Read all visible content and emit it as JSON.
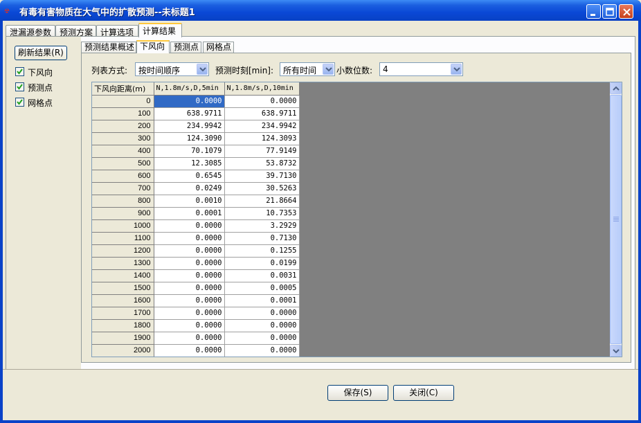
{
  "window": {
    "title": "有毒有害物质在大气中的扩散预测--未标题1",
    "icon": "app-icon",
    "controls": [
      "minimize-icon",
      "maximize-icon",
      "close-icon"
    ]
  },
  "main_tabs": [
    {
      "label": "泄漏源参数"
    },
    {
      "label": "预测方案"
    },
    {
      "label": "计算选项"
    },
    {
      "label": "计算结果",
      "active": true
    }
  ],
  "left_panel": {
    "refresh_label": "刷新结果(R)",
    "checks": [
      {
        "label": "下风向",
        "checked": true
      },
      {
        "label": "预测点",
        "checked": true
      },
      {
        "label": "网格点",
        "checked": true
      }
    ]
  },
  "result_tabs": [
    {
      "label": "预测结果概述"
    },
    {
      "label": "下风向",
      "active": true
    },
    {
      "label": "预测点"
    },
    {
      "label": "网格点"
    }
  ],
  "options": {
    "list_mode_label": "列表方式:",
    "list_mode_value": "按时间顺序",
    "time_label": "预测时刻[min]:",
    "time_value": "所有时间",
    "decimals_label": "小数位数:",
    "decimals_value": "4"
  },
  "table": {
    "headers": [
      "下风向距离(m)",
      "N,1.8m/s,D,5min",
      "N,1.8m/s,D,10min"
    ],
    "rows": [
      [
        "0",
        "0.0000",
        "0.0000"
      ],
      [
        "100",
        "638.9711",
        "638.9711"
      ],
      [
        "200",
        "234.9942",
        "234.9942"
      ],
      [
        "300",
        "124.3090",
        "124.3093"
      ],
      [
        "400",
        "70.1079",
        "77.9149"
      ],
      [
        "500",
        "12.3085",
        "53.8732"
      ],
      [
        "600",
        "0.6545",
        "39.7130"
      ],
      [
        "700",
        "0.0249",
        "30.5263"
      ],
      [
        "800",
        "0.0010",
        "21.8664"
      ],
      [
        "900",
        "0.0001",
        "10.7353"
      ],
      [
        "1000",
        "0.0000",
        "3.2929"
      ],
      [
        "1100",
        "0.0000",
        "0.7130"
      ],
      [
        "1200",
        "0.0000",
        "0.1255"
      ],
      [
        "1300",
        "0.0000",
        "0.0199"
      ],
      [
        "1400",
        "0.0000",
        "0.0031"
      ],
      [
        "1500",
        "0.0000",
        "0.0005"
      ],
      [
        "1600",
        "0.0000",
        "0.0001"
      ],
      [
        "1700",
        "0.0000",
        "0.0000"
      ],
      [
        "1800",
        "0.0000",
        "0.0000"
      ],
      [
        "1900",
        "0.0000",
        "0.0000"
      ],
      [
        "2000",
        "0.0000",
        "0.0000"
      ]
    ],
    "selected_cell": [
      0,
      1
    ]
  },
  "buttons": {
    "save_label": "保存(S)",
    "close_label": "关闭(C)"
  },
  "colors": {
    "titlebar": "#0a48d6",
    "selection": "#316ac5",
    "tab_highlight": "#ffc83c"
  }
}
